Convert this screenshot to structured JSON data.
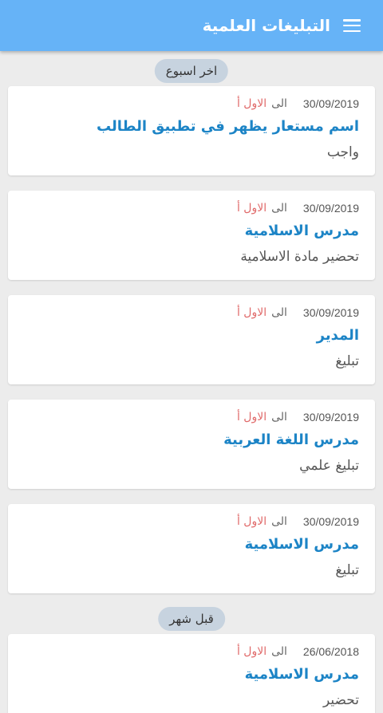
{
  "header": {
    "title": "التبليغات العلمية",
    "menu_icon": "menu-icon"
  },
  "colors": {
    "appbar": "#66b3f7",
    "title": "#1c84c6",
    "class_name": "#e06a6a",
    "chip": "#c7d3df"
  },
  "sections": [
    {
      "label": "اخر اسبوع"
    },
    {
      "label": "قبل شهر"
    }
  ],
  "cards": [
    {
      "date": "30/09/2019",
      "to": "الى",
      "class": "الاول أ",
      "title": "اسم مستعار يظهر في تطبيق الطالب",
      "body": "واجب"
    },
    {
      "date": "30/09/2019",
      "to": "الى",
      "class": "الاول أ",
      "title": "مدرس الاسلامية",
      "body": "تحضير مادة الاسلامية"
    },
    {
      "date": "30/09/2019",
      "to": "الى",
      "class": "الاول أ",
      "title": "المدير",
      "body": "تبليغ"
    },
    {
      "date": "30/09/2019",
      "to": "الى",
      "class": "الاول أ",
      "title": "مدرس اللغة العربية",
      "body": "تبليغ علمي"
    },
    {
      "date": "30/09/2019",
      "to": "الى",
      "class": "الاول أ",
      "title": "مدرس الاسلامية",
      "body": "تبليغ"
    },
    {
      "date": "26/06/2018",
      "to": "الى",
      "class": "الاول أ",
      "title": "مدرس الاسلامية",
      "body": "تحضير"
    }
  ]
}
